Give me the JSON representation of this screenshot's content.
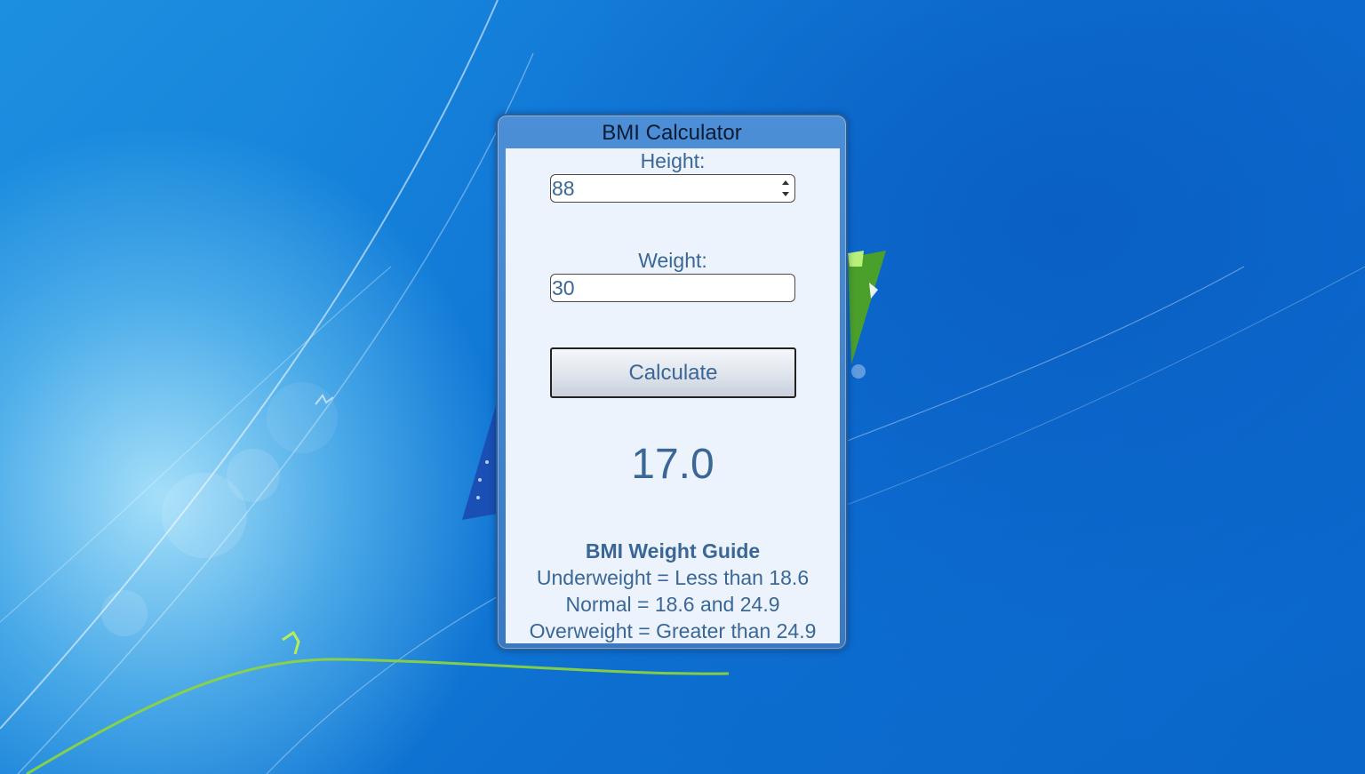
{
  "gadget": {
    "title": "BMI Calculator",
    "height_label": "Height:",
    "height_value": "88",
    "weight_label": "Weight:",
    "weight_value": "30",
    "calculate_label": "Calculate",
    "result": "17.0",
    "guide": {
      "title": "BMI Weight Guide",
      "underweight": "Underweight = Less than 18.6",
      "normal": "Normal = 18.6 and 24.9",
      "overweight": "Overweight = Greater than 24.9"
    }
  },
  "colors": {
    "text_blue": "#3a6796",
    "body_bg": "#edf3fc",
    "frame_blue": "#3a79c2"
  }
}
